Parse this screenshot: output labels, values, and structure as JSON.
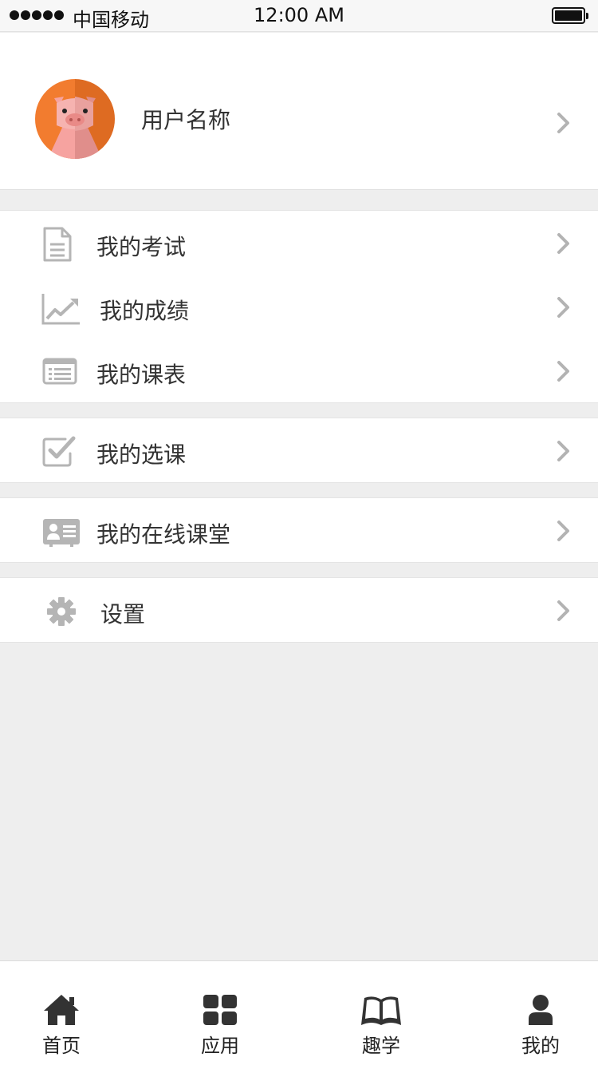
{
  "status_bar": {
    "carrier": "中国移动",
    "time": "12:00 AM",
    "signal_bars": 5
  },
  "profile": {
    "username": "用户名称",
    "avatar_icon": "pig-avatar-icon"
  },
  "menu_groups": [
    [
      {
        "label": "我的考试",
        "icon": "exam-document-icon"
      },
      {
        "label": "我的成绩",
        "icon": "trend-chart-icon"
      },
      {
        "label": "我的课表",
        "icon": "timetable-list-icon"
      }
    ],
    [
      {
        "label": "我的选课",
        "icon": "checkbox-icon"
      }
    ],
    [
      {
        "label": "我的在线课堂",
        "icon": "id-card-icon"
      }
    ],
    [
      {
        "label": "设置",
        "icon": "gear-icon"
      }
    ]
  ],
  "tab_bar": {
    "tabs": [
      {
        "label": "首页",
        "icon": "home-icon"
      },
      {
        "label": "应用",
        "icon": "grid-apps-icon"
      },
      {
        "label": "趣学",
        "icon": "open-book-icon"
      },
      {
        "label": "我的",
        "icon": "person-icon"
      }
    ],
    "active": "我的"
  },
  "colors": {
    "background": "#eeeeee",
    "icon_gray": "#b5b5b5",
    "chevron_gray": "#b3b3b3",
    "avatar_orange": "#f27c2f",
    "tab_icon": "#333333"
  }
}
